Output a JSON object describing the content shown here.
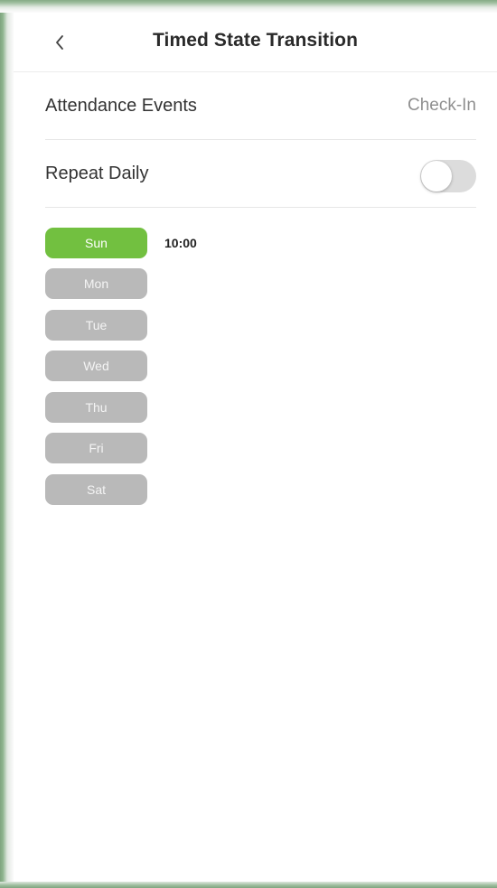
{
  "header": {
    "title": "Timed State Transition"
  },
  "attendance_events": {
    "label": "Attendance Events",
    "value": "Check-In"
  },
  "repeat_daily": {
    "label": "Repeat Daily",
    "enabled": false
  },
  "days": [
    {
      "label": "Sun",
      "active": true,
      "time": "10:00"
    },
    {
      "label": "Mon",
      "active": false,
      "time": ""
    },
    {
      "label": "Tue",
      "active": false,
      "time": ""
    },
    {
      "label": "Wed",
      "active": false,
      "time": ""
    },
    {
      "label": "Thu",
      "active": false,
      "time": ""
    },
    {
      "label": "Fri",
      "active": false,
      "time": ""
    },
    {
      "label": "Sat",
      "active": false,
      "time": ""
    }
  ],
  "colors": {
    "active_day": "#72c040",
    "inactive_day": "#b9b9b9",
    "toggle_off": "#dcdcdc",
    "frame_green": "#7fa57f"
  }
}
